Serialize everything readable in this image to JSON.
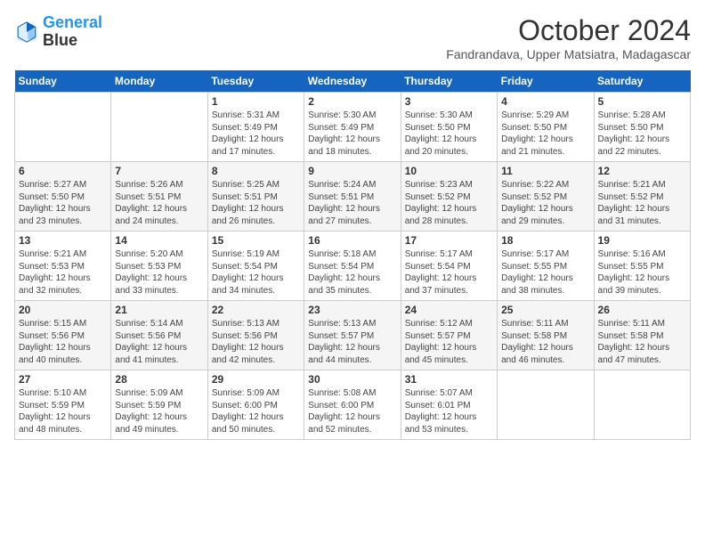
{
  "logo": {
    "line1": "General",
    "line2": "Blue"
  },
  "title": "October 2024",
  "subtitle": "Fandrandava, Upper Matsiatra, Madagascar",
  "days_header": [
    "Sunday",
    "Monday",
    "Tuesday",
    "Wednesday",
    "Thursday",
    "Friday",
    "Saturday"
  ],
  "weeks": [
    [
      {
        "day": "",
        "info": ""
      },
      {
        "day": "",
        "info": ""
      },
      {
        "day": "1",
        "info": "Sunrise: 5:31 AM\nSunset: 5:49 PM\nDaylight: 12 hours and 17 minutes."
      },
      {
        "day": "2",
        "info": "Sunrise: 5:30 AM\nSunset: 5:49 PM\nDaylight: 12 hours and 18 minutes."
      },
      {
        "day": "3",
        "info": "Sunrise: 5:30 AM\nSunset: 5:50 PM\nDaylight: 12 hours and 20 minutes."
      },
      {
        "day": "4",
        "info": "Sunrise: 5:29 AM\nSunset: 5:50 PM\nDaylight: 12 hours and 21 minutes."
      },
      {
        "day": "5",
        "info": "Sunrise: 5:28 AM\nSunset: 5:50 PM\nDaylight: 12 hours and 22 minutes."
      }
    ],
    [
      {
        "day": "6",
        "info": "Sunrise: 5:27 AM\nSunset: 5:50 PM\nDaylight: 12 hours and 23 minutes."
      },
      {
        "day": "7",
        "info": "Sunrise: 5:26 AM\nSunset: 5:51 PM\nDaylight: 12 hours and 24 minutes."
      },
      {
        "day": "8",
        "info": "Sunrise: 5:25 AM\nSunset: 5:51 PM\nDaylight: 12 hours and 26 minutes."
      },
      {
        "day": "9",
        "info": "Sunrise: 5:24 AM\nSunset: 5:51 PM\nDaylight: 12 hours and 27 minutes."
      },
      {
        "day": "10",
        "info": "Sunrise: 5:23 AM\nSunset: 5:52 PM\nDaylight: 12 hours and 28 minutes."
      },
      {
        "day": "11",
        "info": "Sunrise: 5:22 AM\nSunset: 5:52 PM\nDaylight: 12 hours and 29 minutes."
      },
      {
        "day": "12",
        "info": "Sunrise: 5:21 AM\nSunset: 5:52 PM\nDaylight: 12 hours and 31 minutes."
      }
    ],
    [
      {
        "day": "13",
        "info": "Sunrise: 5:21 AM\nSunset: 5:53 PM\nDaylight: 12 hours and 32 minutes."
      },
      {
        "day": "14",
        "info": "Sunrise: 5:20 AM\nSunset: 5:53 PM\nDaylight: 12 hours and 33 minutes."
      },
      {
        "day": "15",
        "info": "Sunrise: 5:19 AM\nSunset: 5:54 PM\nDaylight: 12 hours and 34 minutes."
      },
      {
        "day": "16",
        "info": "Sunrise: 5:18 AM\nSunset: 5:54 PM\nDaylight: 12 hours and 35 minutes."
      },
      {
        "day": "17",
        "info": "Sunrise: 5:17 AM\nSunset: 5:54 PM\nDaylight: 12 hours and 37 minutes."
      },
      {
        "day": "18",
        "info": "Sunrise: 5:17 AM\nSunset: 5:55 PM\nDaylight: 12 hours and 38 minutes."
      },
      {
        "day": "19",
        "info": "Sunrise: 5:16 AM\nSunset: 5:55 PM\nDaylight: 12 hours and 39 minutes."
      }
    ],
    [
      {
        "day": "20",
        "info": "Sunrise: 5:15 AM\nSunset: 5:56 PM\nDaylight: 12 hours and 40 minutes."
      },
      {
        "day": "21",
        "info": "Sunrise: 5:14 AM\nSunset: 5:56 PM\nDaylight: 12 hours and 41 minutes."
      },
      {
        "day": "22",
        "info": "Sunrise: 5:13 AM\nSunset: 5:56 PM\nDaylight: 12 hours and 42 minutes."
      },
      {
        "day": "23",
        "info": "Sunrise: 5:13 AM\nSunset: 5:57 PM\nDaylight: 12 hours and 44 minutes."
      },
      {
        "day": "24",
        "info": "Sunrise: 5:12 AM\nSunset: 5:57 PM\nDaylight: 12 hours and 45 minutes."
      },
      {
        "day": "25",
        "info": "Sunrise: 5:11 AM\nSunset: 5:58 PM\nDaylight: 12 hours and 46 minutes."
      },
      {
        "day": "26",
        "info": "Sunrise: 5:11 AM\nSunset: 5:58 PM\nDaylight: 12 hours and 47 minutes."
      }
    ],
    [
      {
        "day": "27",
        "info": "Sunrise: 5:10 AM\nSunset: 5:59 PM\nDaylight: 12 hours and 48 minutes."
      },
      {
        "day": "28",
        "info": "Sunrise: 5:09 AM\nSunset: 5:59 PM\nDaylight: 12 hours and 49 minutes."
      },
      {
        "day": "29",
        "info": "Sunrise: 5:09 AM\nSunset: 6:00 PM\nDaylight: 12 hours and 50 minutes."
      },
      {
        "day": "30",
        "info": "Sunrise: 5:08 AM\nSunset: 6:00 PM\nDaylight: 12 hours and 52 minutes."
      },
      {
        "day": "31",
        "info": "Sunrise: 5:07 AM\nSunset: 6:01 PM\nDaylight: 12 hours and 53 minutes."
      },
      {
        "day": "",
        "info": ""
      },
      {
        "day": "",
        "info": ""
      }
    ]
  ]
}
